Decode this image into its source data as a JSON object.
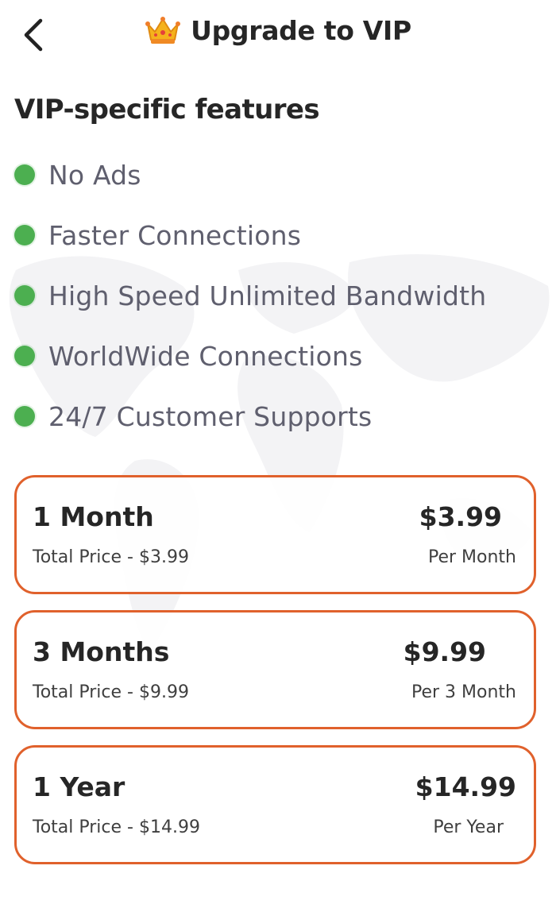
{
  "header": {
    "title": "Upgrade to VIP",
    "back_icon": "chevron-left-icon",
    "crown_icon": "crown-icon"
  },
  "section": {
    "title": "VIP-specific features"
  },
  "features": [
    {
      "label": "No Ads"
    },
    {
      "label": "Faster Connections"
    },
    {
      "label": "High Speed Unlimited Bandwidth"
    },
    {
      "label": "WorldWide Connections"
    },
    {
      "label": "24/7 Customer Supports"
    }
  ],
  "plans": [
    {
      "name": "1 Month",
      "total": "Total Price - $3.99",
      "price": "$3.99",
      "period": "Per Month"
    },
    {
      "name": "3 Months",
      "total": "Total Price - $9.99",
      "price": "$9.99",
      "period": "Per 3 Month"
    },
    {
      "name": "1 Year",
      "total": "Total Price - $14.99",
      "price": "$14.99",
      "period": "Per Year"
    }
  ],
  "colors": {
    "accent_border": "#e0612c",
    "bullet_green": "#4caf50",
    "title_text": "#262626",
    "feature_text": "#5f5f6e"
  }
}
